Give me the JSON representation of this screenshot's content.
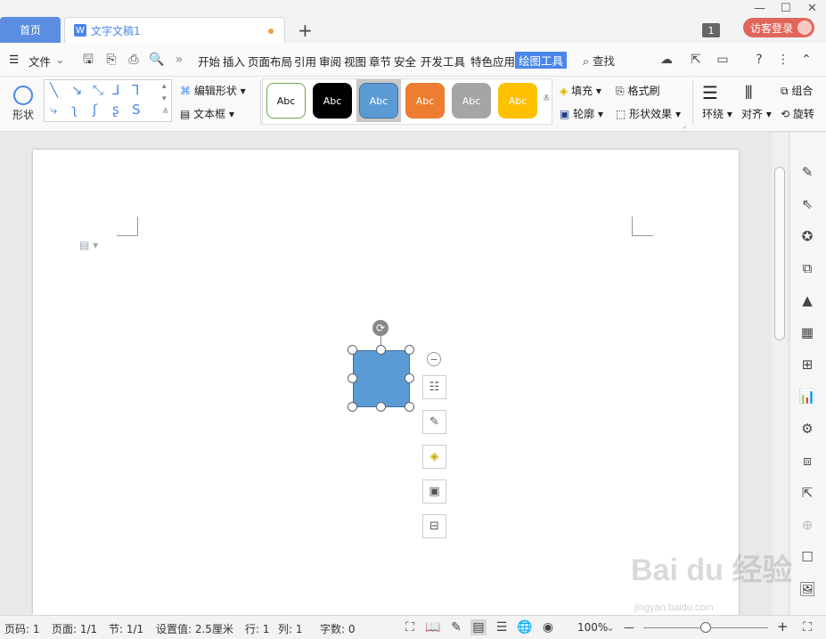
{
  "tabs": {
    "home": "首页",
    "doc_badge": "W",
    "doc_title": "文字文稿1",
    "add": "+"
  },
  "window": {
    "count": "1",
    "login": "访客登录",
    "minimize": "—",
    "maximize": "☐",
    "close": "✕"
  },
  "menu": {
    "file": "文件",
    "expand": "»",
    "items": [
      "开始",
      "插入",
      "页面布局",
      "引用",
      "审阅",
      "视图",
      "章节",
      "安全",
      "开发工具",
      "特色应用"
    ],
    "active": "绘图工具",
    "search": "查找"
  },
  "ribbon": {
    "shape": "形状",
    "edit_shape": "编辑形状",
    "text_box": "文本框",
    "styles": [
      "Abc",
      "Abc",
      "Abc",
      "Abc",
      "Abc",
      "Abc"
    ],
    "style_colors": [
      "#ffffff",
      "#000000",
      "#5b9bd5",
      "#ed7d31",
      "#a5a5a5",
      "#ffc000"
    ],
    "fill": "填充",
    "outline": "轮廓",
    "format_painter": "格式刷",
    "shape_effects": "形状效果",
    "wrap": "环绕",
    "align": "对齐",
    "group": "组合",
    "rotate": "旋转"
  },
  "status": {
    "page_no": "页码: 1",
    "pages": "页面: 1/1",
    "section": "节: 1/1",
    "setting": "设置值: 2.5厘米",
    "row": "行: 1",
    "col": "列: 1",
    "words": "字数: 0",
    "zoom": "100%",
    "zoom_minus": "—",
    "zoom_plus": "+"
  },
  "zoom_level": 0.5,
  "watermark": {
    "logo": "Bai du 经验",
    "url": "jingyan.baidu.com"
  },
  "colors": {
    "accent": "#4a86e8",
    "shape_fill": "#5b9bd5",
    "login": "#e0665c"
  }
}
